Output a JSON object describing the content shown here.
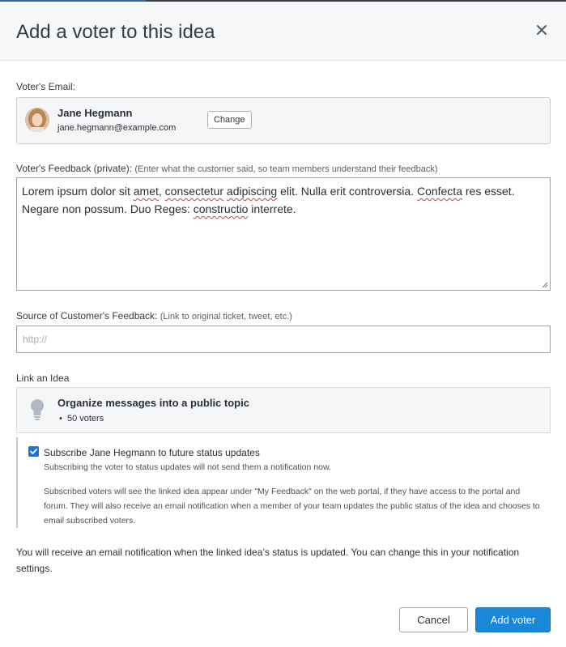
{
  "dialog": {
    "title": "Add a voter to this idea",
    "close_icon": "close-icon"
  },
  "voter": {
    "label": "Voter's Email:",
    "name": "Jane Hegmann",
    "email": "jane.hegmann@example.com",
    "change_label": "Change"
  },
  "feedback": {
    "label": "Voter's Feedback (private):",
    "hint": "(Enter what the customer said, so team members understand their feedback)",
    "value": "Lorem ipsum dolor sit amet, consectetur adipiscing elit. Nulla erit controversia. Confecta res esset. Negare non possum. Duo Reges: constructio interrete.",
    "misspelled": [
      "amet",
      "consectetur",
      "adipiscing",
      "Confecta",
      "constructio"
    ]
  },
  "source": {
    "label": "Source of Customer's Feedback:",
    "hint": "(Link to original ticket, tweet, etc.)",
    "placeholder": "http://"
  },
  "idea": {
    "label": "Link an Idea",
    "title": "Organize messages into a public topic",
    "voters": "50 voters",
    "icon": "lightbulb-icon"
  },
  "subscribe": {
    "checked": true,
    "label": "Subscribe Jane Hegmann to future status updates",
    "note": "Subscribing the voter to status updates will not send them a notification now.",
    "description": "Subscribed voters will see the linked idea appear under \"My Feedback\" on the web portal, if they have access to the portal and forum. They will also receive an email notification when a member of your team updates the public status of the idea and chooses to email subscribed voters."
  },
  "notice": "You will receive an email notification when the linked idea’s status is updated. You can change this in your notification settings.",
  "buttons": {
    "cancel": "Cancel",
    "add": "Add voter"
  },
  "colors": {
    "primary_button": "#1a87d8",
    "checkbox": "#1a73e8",
    "header_bg": "#f6f7f8"
  }
}
